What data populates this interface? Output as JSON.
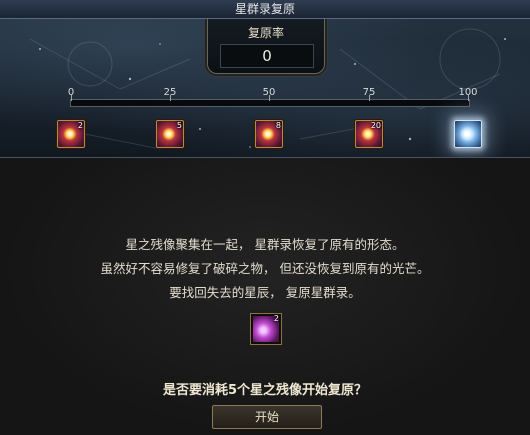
{
  "window": {
    "title": "星群录复原"
  },
  "restore": {
    "label": "复原率",
    "value": "0"
  },
  "track": {
    "ticks": [
      "0",
      "25",
      "50",
      "75",
      "100"
    ],
    "progress_fraction": 0
  },
  "milestones": [
    {
      "at": "0",
      "count": "2",
      "icon": "star-fragment-icon"
    },
    {
      "at": "25",
      "count": "5",
      "icon": "star-fragment-icon"
    },
    {
      "at": "50",
      "count": "8",
      "icon": "star-fragment-icon"
    },
    {
      "at": "75",
      "count": "20",
      "icon": "star-fragment-icon"
    },
    {
      "at": "100",
      "count": "",
      "icon": "constellation-crystal-icon"
    }
  ],
  "description": {
    "line1": "星之残像聚集在一起， 星群录恢复了原有的形态。",
    "line2": "虽然好不容易修复了破碎之物， 但还没恢复到原有的光芒。",
    "line3": "要找回失去的星辰， 复原星群录。"
  },
  "cost_item": {
    "count": "2",
    "icon": "star-afterimage-icon"
  },
  "prompt": {
    "question": "是否要消耗5个星之残像开始复原？"
  },
  "actions": {
    "start_label": "开始"
  },
  "colors": {
    "accent_gold": "#b88d3a",
    "panel_blue": "#23313f",
    "background": "#151515"
  }
}
